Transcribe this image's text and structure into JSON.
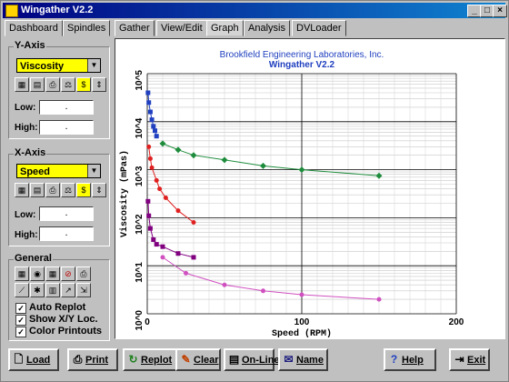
{
  "window": {
    "title": "Wingather V2.2"
  },
  "tabs": [
    "Dashboard",
    "Spindles",
    "Gather",
    "View/Edit",
    "Graph",
    "Analysis",
    "DVLoader"
  ],
  "active_tab": "Graph",
  "y_axis": {
    "label": "Y-Axis",
    "selected": "Viscosity",
    "low_label": "Low:",
    "high_label": "High:",
    "low_value": ".",
    "high_value": "."
  },
  "x_axis": {
    "label": "X-Axis",
    "selected": "Speed",
    "low_label": "Low:",
    "high_label": "High:",
    "low_value": ".",
    "high_value": "."
  },
  "general": {
    "label": "General",
    "checkboxes": [
      {
        "label": "Auto Replot",
        "checked": true
      },
      {
        "label": "Show X/Y Loc.",
        "checked": true
      },
      {
        "label": "Color Printouts",
        "checked": true
      }
    ]
  },
  "buttons": [
    "Load",
    "Print",
    "Replot",
    "Clear",
    "On-Line",
    "Name",
    "Help",
    "Exit"
  ],
  "chart_data": {
    "type": "scatter",
    "title": "Brookfield Engineering Laboratories, Inc.",
    "subtitle": "Wingather V2.2",
    "xlabel": "Speed (RPM)",
    "ylabel": "Viscosity (mPas)",
    "xlim": [
      0,
      200
    ],
    "ylim": [
      1,
      100000
    ],
    "y_scale": "log",
    "x_ticks": [
      "0",
      "100",
      "200"
    ],
    "y_ticks": [
      "10^0",
      "10^1",
      "10^2",
      "10^3",
      "10^4",
      "10^5"
    ],
    "grid": true,
    "colors": {
      "background": "#ffffff",
      "plot_frame": "#808080",
      "title_color": "#1f3fbf",
      "label_color": "#000000",
      "accent_yellow": "#ffff00"
    },
    "series": [
      {
        "color": "#2040c0",
        "marker": "square",
        "x": [
          0.5,
          1,
          2,
          3,
          4,
          5,
          6
        ],
        "y": [
          40000,
          25000,
          16000,
          11000,
          8000,
          6500,
          5000
        ]
      },
      {
        "color": "#1e8c3c",
        "marker": "diamond",
        "x": [
          10,
          20,
          30,
          50,
          75,
          100,
          150
        ],
        "y": [
          3500,
          2600,
          2000,
          1600,
          1200,
          1000,
          750
        ]
      },
      {
        "color": "#e02020",
        "marker": "circle",
        "x": [
          1,
          2,
          3,
          6,
          8,
          12,
          20,
          30
        ],
        "y": [
          3000,
          1700,
          1100,
          600,
          400,
          260,
          140,
          80
        ]
      },
      {
        "color": "#800080",
        "marker": "square",
        "x": [
          0.5,
          1,
          2,
          4,
          6,
          10,
          20,
          30
        ],
        "y": [
          220,
          110,
          60,
          35,
          28,
          25,
          18,
          15
        ]
      },
      {
        "color": "#d050c0",
        "marker": "circle",
        "x": [
          10,
          25,
          50,
          75,
          100,
          150
        ],
        "y": [
          15,
          7,
          4,
          3,
          2.5,
          2
        ]
      }
    ]
  }
}
